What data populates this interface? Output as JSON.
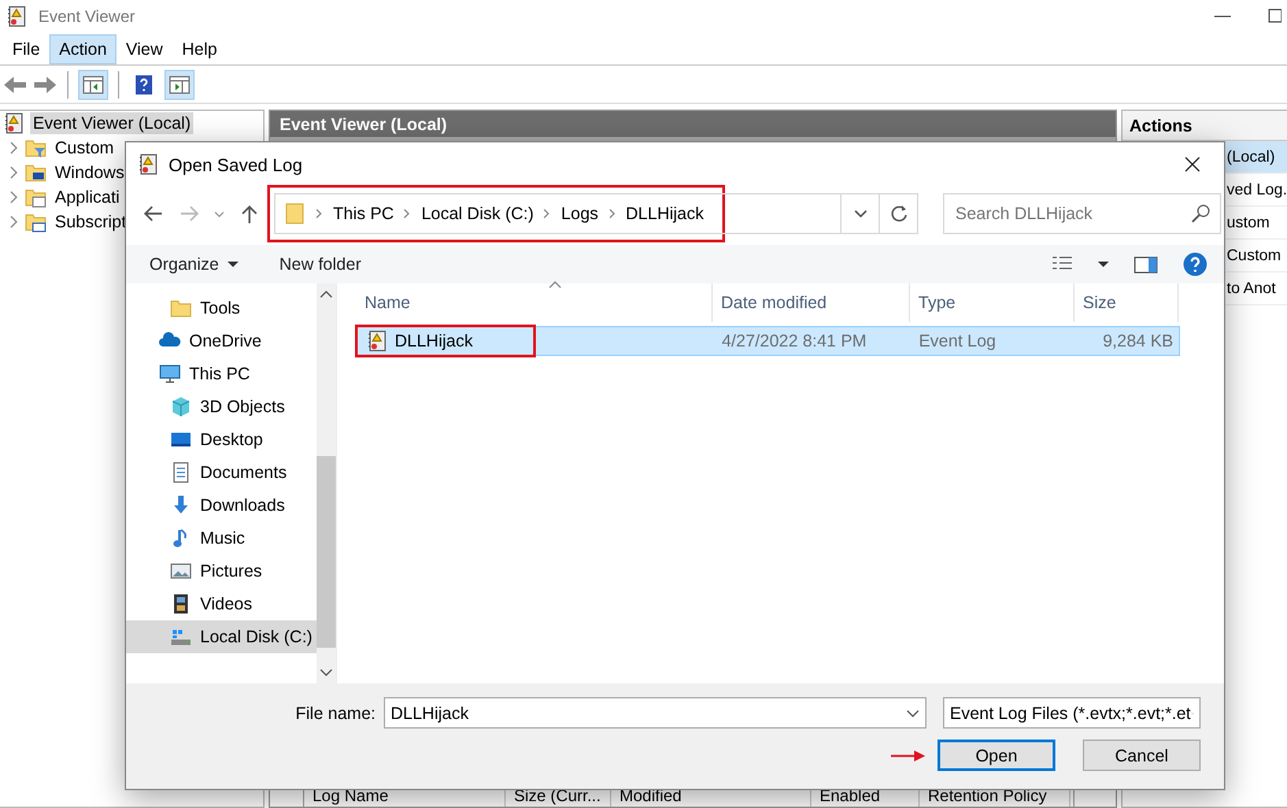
{
  "window": {
    "title": "Event Viewer"
  },
  "menu": [
    {
      "label": "File",
      "selected": false
    },
    {
      "label": "Action",
      "selected": true
    },
    {
      "label": "View",
      "selected": false
    },
    {
      "label": "Help",
      "selected": false
    }
  ],
  "tree": [
    {
      "label": "Event Viewer (Local)",
      "selected": true,
      "children": [
        {
          "label": "Custom",
          "kind": "filter",
          "selected": false
        },
        {
          "label": "Windows",
          "kind": "windows",
          "selected": false
        },
        {
          "label": "Applicati",
          "kind": "app",
          "selected": false
        },
        {
          "label": "Subscript",
          "kind": "subscription",
          "selected": false
        }
      ]
    }
  ],
  "center": {
    "title": "Event Viewer (Local)",
    "columns": [
      "Log Name",
      "Size (Curr...",
      "Modified",
      "Enabled",
      "Retention Policy"
    ]
  },
  "actions": {
    "title": "Actions",
    "items": [
      {
        "label": "(Local)",
        "selected": true
      },
      {
        "label": "ved Log.",
        "selected": false
      },
      {
        "label": "ustom",
        "selected": false
      },
      {
        "label": "Custom",
        "selected": false
      },
      {
        "label": "to Anot",
        "selected": false
      }
    ]
  },
  "dialog": {
    "title": "Open Saved Log",
    "address": {
      "highlighted": true,
      "crumbs": [
        "This PC",
        "Local Disk (C:)",
        "Logs",
        "DLLHijack"
      ]
    },
    "search": {
      "placeholder": "Search DLLHijack"
    },
    "commands": [
      "Organize",
      "New folder"
    ],
    "nav": [
      {
        "children": [
          {
            "label": "Tools",
            "kind": "folder",
            "selected": false
          }
        ]
      },
      {
        "label": "OneDrive",
        "kind": "cloud",
        "selected": false
      },
      {
        "label": "This PC",
        "kind": "pc",
        "selected": false,
        "children": [
          {
            "label": "3D Objects",
            "kind": "cube",
            "selected": false
          },
          {
            "label": "Desktop",
            "kind": "desktop",
            "selected": false
          },
          {
            "label": "Documents",
            "kind": "document",
            "selected": false
          },
          {
            "label": "Downloads",
            "kind": "download",
            "selected": false
          },
          {
            "label": "Music",
            "kind": "music",
            "selected": false
          },
          {
            "label": "Pictures",
            "kind": "picture",
            "selected": false
          },
          {
            "label": "Videos",
            "kind": "video",
            "selected": false
          },
          {
            "label": "Local Disk (C:)",
            "kind": "drive",
            "selected": true
          }
        ]
      }
    ],
    "columns": [
      "Name",
      "Date modified",
      "Type",
      "Size"
    ],
    "files": [
      {
        "name": "DLLHijack",
        "date": "4/27/2022 8:41 PM",
        "type": "Event Log",
        "size": "9,284 KB",
        "selected": true,
        "highlighted": true
      }
    ],
    "file_name_label": "File name:",
    "file_name": "DLLHijack",
    "filter": "Event Log Files (*.evtx;*.evt;*.et",
    "buttons": [
      {
        "label": "Open",
        "default": true,
        "pointer": true
      },
      {
        "label": "Cancel",
        "default": false,
        "pointer": false
      }
    ]
  }
}
